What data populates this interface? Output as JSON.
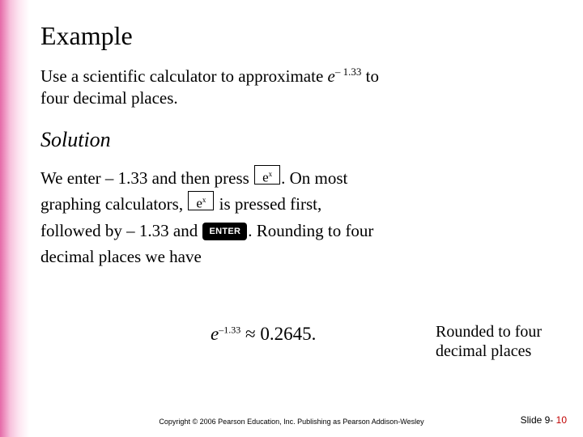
{
  "heading": "Example",
  "problem": {
    "line1a": "Use a scientific calculator to approximate ",
    "e": "e",
    "exp_neg": "– 1.33",
    "line1b": " to",
    "line2": "four decimal places."
  },
  "solution_heading": "Solution",
  "body": {
    "p1a": "We enter – 1.33 and then press ",
    "key_e": "e",
    "key_x": "x",
    "p1b": ".  On most",
    "p2a": "graphing calculators, ",
    "p2b": " is pressed first,",
    "p3a": "followed by – 1.33 and ",
    "enter": "ENTER",
    "p3b": ".  Rounding to four",
    "p4": "decimal places we have"
  },
  "equation": {
    "lhs_e": "e",
    "lhs_exp": "–1.33",
    "approx": " ≈ 0.2645."
  },
  "rounded_note_l1": "Rounded to four",
  "rounded_note_l2": "decimal places",
  "copyright": "Copyright © 2006 Pearson Education, Inc.  Publishing as Pearson Addison-Wesley",
  "slide_label": "Slide 9- ",
  "slide_no": "10"
}
